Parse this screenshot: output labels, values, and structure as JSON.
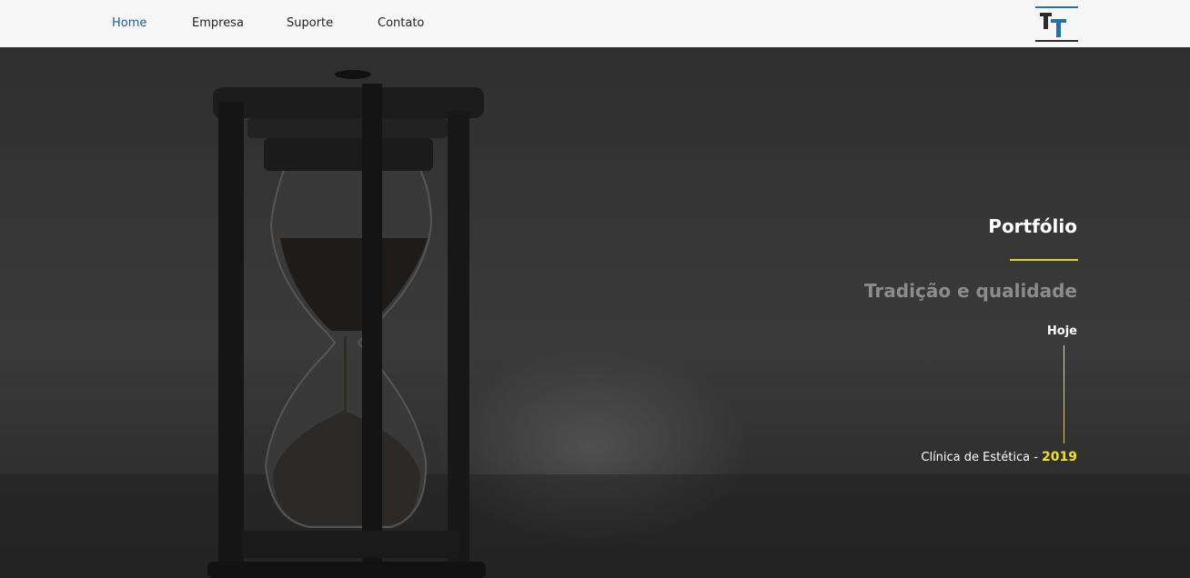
{
  "nav": {
    "items": [
      {
        "label": "Home",
        "active": true
      },
      {
        "label": "Empresa",
        "active": false
      },
      {
        "label": "Suporte",
        "active": false
      },
      {
        "label": "Contato",
        "active": false
      }
    ],
    "logo_icon": "tt-logo-icon"
  },
  "hero": {
    "background_icon": "hourglass-photo",
    "title": "Portfólio",
    "tagline": "Tradição e qualidade",
    "timeline": {
      "top_label": "Hoje",
      "entry_text": "Clínica de Estética -",
      "entry_year": "2019"
    }
  },
  "colors": {
    "nav_active": "#1a5c98",
    "accent_yellow": "#e6d31c",
    "year_yellow": "#f0e516",
    "logo_blue": "#1f6fb5",
    "logo_dark": "#2b2b2b"
  }
}
